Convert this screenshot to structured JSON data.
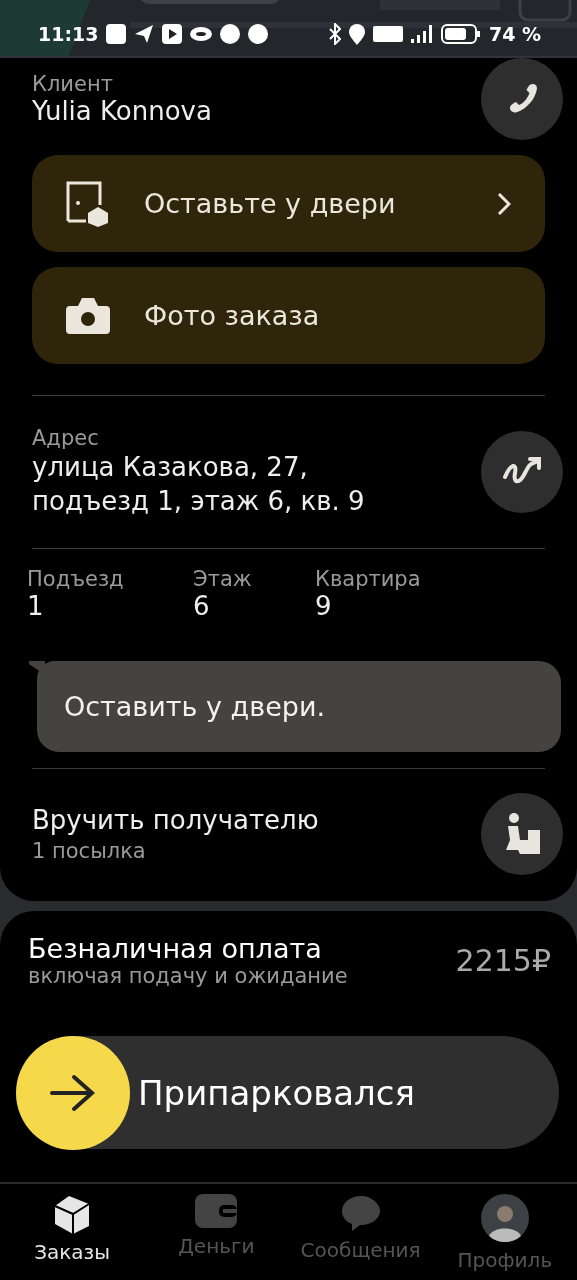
{
  "status_bar": {
    "time": "11:13",
    "battery": "74 %"
  },
  "client": {
    "label": "Клиент",
    "name": "Yulia Konnova"
  },
  "actions": [
    {
      "kind": "door",
      "label": "Оставьте у двери",
      "chevron": true
    },
    {
      "kind": "camera",
      "label": "Фото заказа",
      "chevron": false
    }
  ],
  "address": {
    "label": "Адрес",
    "lines": [
      "улица Казакова, 27,",
      "подъезд 1, этаж 6, кв. 9"
    ]
  },
  "details": [
    {
      "label": "Подъезд",
      "value": "1"
    },
    {
      "label": "Этаж",
      "value": "6"
    },
    {
      "label": "Квартира",
      "value": "9"
    }
  ],
  "comment": "Оставить у двери.",
  "handover": {
    "title": "Вручить получателю",
    "subtitle": "1 посылка"
  },
  "payment": {
    "title": "Безналичная оплата",
    "subtitle": "включая подачу и ожидание",
    "amount": "2215₽"
  },
  "slider": {
    "label": "Припарковался",
    "level": 0
  },
  "nav": [
    {
      "kind": "orders",
      "label": "Заказы",
      "selected": true
    },
    {
      "kind": "money",
      "label": "Деньги",
      "selected": false
    },
    {
      "kind": "messages",
      "label": "Сообщения",
      "selected": false
    },
    {
      "kind": "profile",
      "label": "Профиль",
      "selected": false
    }
  ]
}
